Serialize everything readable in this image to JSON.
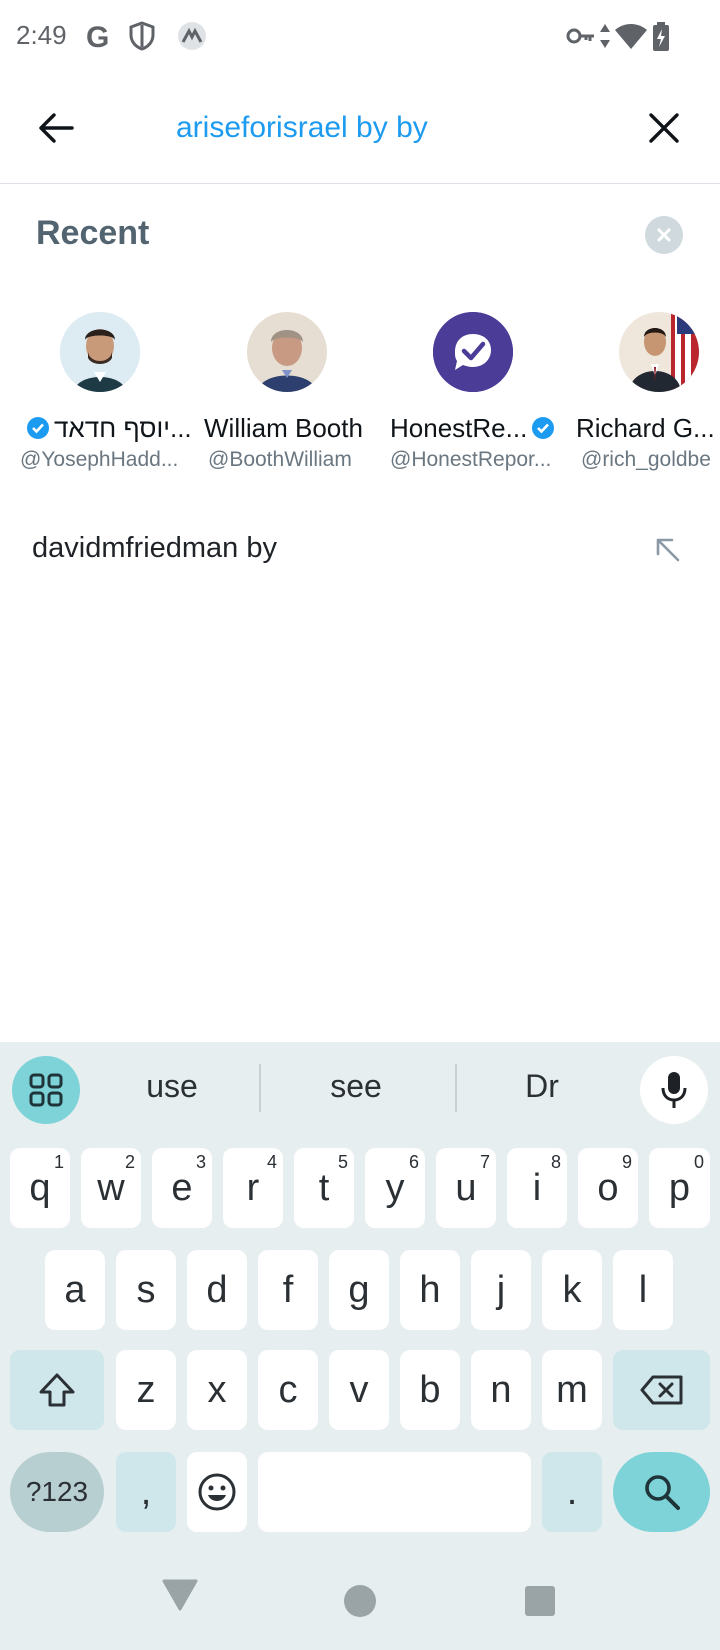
{
  "status_bar": {
    "time": "2:49",
    "left_icons": [
      "google-icon",
      "shield-icon",
      "vpn-app-icon"
    ],
    "right_icons": [
      "key-icon",
      "data-arrows-icon",
      "wifi-icon",
      "battery-charging-icon"
    ]
  },
  "search": {
    "query": "ariseforisrael by by"
  },
  "recent": {
    "title": "Recent",
    "users": [
      {
        "name": "יוסף חדאד...",
        "handle": "@YosephHadd...",
        "verified": true
      },
      {
        "name": "William Booth",
        "handle": "@BoothWilliam",
        "verified": false
      },
      {
        "name": "HonestRe...",
        "handle": "@HonestRepor...",
        "verified": true
      },
      {
        "name": "Richard G...",
        "handle": "@rich_goldbe",
        "verified": false
      }
    ],
    "queries": [
      {
        "text": "davidmfriedman by"
      }
    ]
  },
  "keyboard": {
    "suggestions": [
      "use",
      "see",
      "Dr"
    ],
    "row1": [
      {
        "k": "q",
        "h": "1"
      },
      {
        "k": "w",
        "h": "2"
      },
      {
        "k": "e",
        "h": "3"
      },
      {
        "k": "r",
        "h": "4"
      },
      {
        "k": "t",
        "h": "5"
      },
      {
        "k": "y",
        "h": "6"
      },
      {
        "k": "u",
        "h": "7"
      },
      {
        "k": "i",
        "h": "8"
      },
      {
        "k": "o",
        "h": "9"
      },
      {
        "k": "p",
        "h": "0"
      }
    ],
    "row2": [
      "a",
      "s",
      "d",
      "f",
      "g",
      "h",
      "j",
      "k",
      "l"
    ],
    "row3": [
      "z",
      "x",
      "c",
      "v",
      "b",
      "n",
      "m"
    ],
    "symbols_key": "?123",
    "comma_key": ",",
    "period_key": "."
  },
  "colors": {
    "accent": "#1d9bf0",
    "keyboard_bg": "#e7eeef",
    "keyboard_accent": "#7dd3d8",
    "verified": "#1d9bf0",
    "honest_reporting": "#4a3c97"
  }
}
